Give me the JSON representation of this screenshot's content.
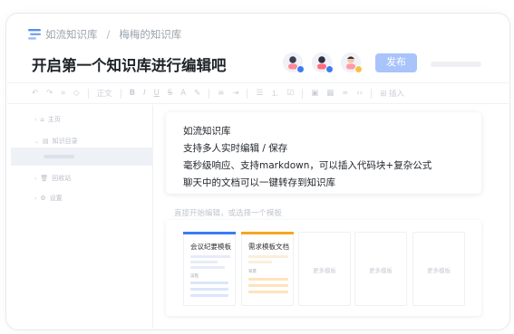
{
  "breadcrumb": {
    "space": "如流知识库",
    "page": "梅梅的知识库"
  },
  "document": {
    "title": "开启第一个知识库进行编辑吧"
  },
  "header": {
    "publish_label": "发布"
  },
  "collaborators": [
    {
      "icon": "avatar-user-1",
      "status_color": "#3d7bf5"
    },
    {
      "icon": "avatar-user-2",
      "status_color": "#3d7bf5"
    },
    {
      "icon": "avatar-user-3",
      "status_color": "#f6c244"
    }
  ],
  "toolbar": {
    "font_style": "正文",
    "insert_label": "插入"
  },
  "sidebar": {
    "items": [
      {
        "label": "主页",
        "icon": "home-icon"
      },
      {
        "label": "知识目录",
        "icon": "folder-icon"
      },
      {
        "label": "回收站",
        "icon": "trash-icon"
      },
      {
        "label": "设置",
        "icon": "settings-icon"
      }
    ]
  },
  "content": {
    "lines": [
      "如流知识库",
      "支持多人实时编辑 / 保存",
      "毫秒级响应、支持markdown，可以插入代码块+复杂公式",
      "聊天中的文档可以一键转存到知识库"
    ]
  },
  "templates": {
    "hint": "直接开始编辑，或选择一个模板",
    "items": [
      {
        "name": "会议纪要模板",
        "sub": "议程",
        "accent": "#3d7bf5"
      },
      {
        "name": "需求模板文档",
        "sub": "背景",
        "accent": "#f5a623"
      }
    ],
    "more_label": "更多模板"
  },
  "colors": {
    "accent": "#3d7bf5",
    "publish_bg": "#a9c3fb",
    "logo": "#5a8dee"
  }
}
